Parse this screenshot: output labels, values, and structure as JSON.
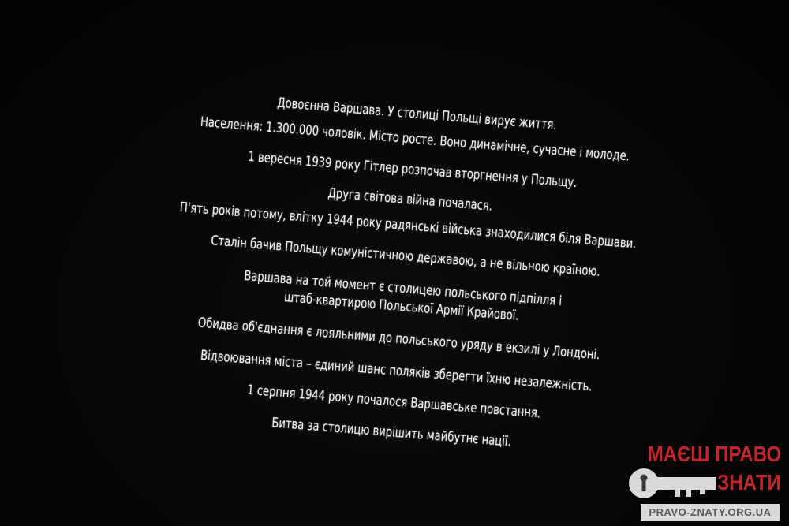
{
  "screen_text": {
    "lines": [
      "Довоєнна Варшава. У столиці Польщі вирує життя.",
      "Населення: 1.300.000 чоловік. Місто росте. Воно динамічне, сучасне і молоде.",
      "1 вересня 1939 року Гітлер розпочав вторгнення у Польщу.",
      "Друга світова війна почалася.",
      "П'ять років потому, влітку 1944 року радянські війська знаходилися біля Варшави.",
      "Сталін бачив Польщу комуністичною державою, а не вільною країною.",
      "Варшава на той момент є столицею польського підпілля і",
      "штаб-квартирою Польської Армії Крайової.",
      "Обидва об'єднання є лояльними до польського уряду в екзилі у Лондоні.",
      "Відвоювання міста – єдиний шанс поляків зберегти їхню незалежність.",
      "1 серпня 1944 року почалося Варшавське повстання.",
      "Битва за столицю вирішить майбутнє нації."
    ]
  },
  "watermark": {
    "line1": "МАЄШ ПРАВО",
    "line2": "ЗНАТИ",
    "url": "PRAVO-ZNATY.ORG.UA",
    "icon": "key-icon",
    "accent_color": "#c0262c",
    "gray_color": "#d9d9d9"
  }
}
